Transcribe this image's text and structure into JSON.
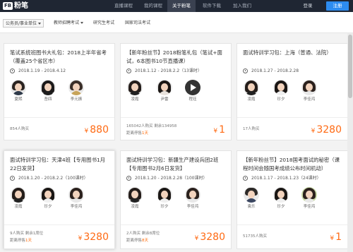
{
  "header": {
    "logo_mark": "FB",
    "logo_text": "粉笔",
    "nav": [
      "直播课程",
      "我的课程",
      "关于粉笔",
      "软件下载",
      "加入我们"
    ],
    "active_nav": "关于粉笔",
    "login_label": "登录",
    "register_label": "注册"
  },
  "filters": {
    "category_selected": "公务员/事业单位",
    "items": [
      "教师招聘考试",
      "研究生考试",
      "国家司法考试"
    ]
  },
  "cards": [
    {
      "title": "笔试系统班图书大礼包：2018上半年省考（覆盖25个省区市）",
      "dates": "2018.1.19 - 2018.4.12",
      "teachers": [
        "夏熙",
        "吾四",
        "李元振"
      ],
      "buyers": "854人购买",
      "remain_prefix": "",
      "remain_count": "",
      "price": "880"
    },
    {
      "title": "【新年粉丝节】2018粉笔礼包（笔试+面试，6本图书10节直播课）",
      "dates": "2018.1.12 - 2018.2.2（13课时）",
      "teachers": [
        "凌霞",
        "尹雷",
        "程珏"
      ],
      "buyers": "165042人购买 剩余134958",
      "remain_prefix": "距离停售",
      "remain_count": "1天",
      "price": "1"
    },
    {
      "title": "面试特训学习包：上海（普通、法院）",
      "dates": "2018.1.27 - 2018.2.28",
      "teachers": [
        "凌霞",
        "珍夕",
        "李佳鸿"
      ],
      "buyers": "17人购买",
      "remain_prefix": "",
      "remain_count": "",
      "price": "3280"
    },
    {
      "title": "面试特训学习包：天津4班【专用图书1月22日发货】",
      "dates": "2018.1.20 - 2018.2.2（100课时）",
      "teachers": [
        "凌霞",
        "珍夕",
        "李佳鸿"
      ],
      "buyers": "9人购买 剩余1席位",
      "remain_prefix": "距离停售",
      "remain_count": "1天",
      "price": "3280"
    },
    {
      "title": "面试特训学习包：新疆生产建设兵团2班【专用图书2月6日发货】",
      "dates": "2018.1.20 - 2018.2.28（100课时）",
      "teachers": [
        "凌霞",
        "珍夕",
        "李佳鸿"
      ],
      "buyers": "2人购买 剩余8席位",
      "remain_prefix": "距离停售",
      "remain_count": "8天",
      "price": "3280"
    },
    {
      "title": "【新年粉丝节】2018国考面试的秘密（课程时间会随国考成绩公布时间机动）",
      "dates": "2018.1.17 - 2018.1.23（24课时）",
      "teachers": [
        "袁乐",
        "珍夕",
        "李佳鸿"
      ],
      "buyers": "51735人购买",
      "remain_prefix": "",
      "remain_count": "",
      "price": "1"
    }
  ],
  "currency_symbol": "¥",
  "colors": {
    "topbar": "#1f2633",
    "accent_blue": "#2d8cf0",
    "price_orange": "#ff6a13"
  }
}
